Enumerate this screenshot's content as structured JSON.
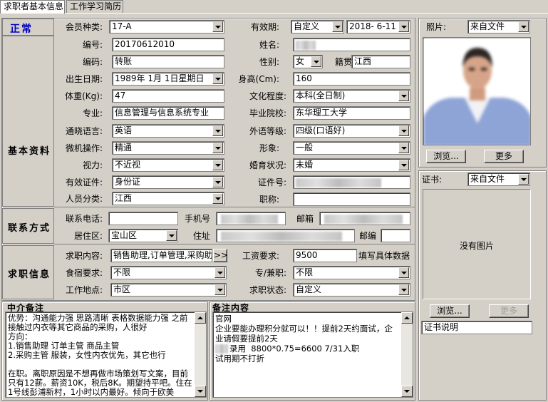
{
  "tabs": [
    {
      "label": "求职者基本信息"
    },
    {
      "label": "工作学习简历"
    }
  ],
  "status": {
    "text": "正常",
    "color": "#0000c0"
  },
  "sections": {
    "basic": "基本资料",
    "contact": "联系方式",
    "job": "求职信息",
    "agent_note": "中介备注",
    "remark": "备注内容"
  },
  "labels": {
    "member_type": "会员种类:",
    "validity": "有效期:",
    "number": "编号:",
    "name": "姓名:",
    "code": "编码:",
    "gender": "性别:",
    "native": "籍贯",
    "birth": "出生日期:",
    "height": "身高(Cm):",
    "weight": "体重(Kg):",
    "education": "文化程度:",
    "major": "专业:",
    "school": "毕业院校:",
    "dialect": "通晓语言:",
    "foreign": "外语等级:",
    "computer": "微机操作:",
    "appearance": "形象:",
    "vision": "视力:",
    "marital": "婚育状况:",
    "id_type": "有效证件:",
    "id_no": "证件号:",
    "category": "人员分类:",
    "title": "职称:",
    "phone": "联系电话:",
    "mobile": "手机号",
    "email": "邮箱",
    "area": "居住区:",
    "address": "住址",
    "zip": "邮编",
    "job_content": "求职内容:",
    "salary": "工资要求:",
    "salary_hint": "填写具体数据",
    "meal": "食宿要求:",
    "fulltime": "专/兼职:",
    "location": "工作地点:",
    "job_status": "求职状态:",
    "photo": "照片:",
    "cert": "证书:"
  },
  "values": {
    "member_type": "17-A",
    "validity_type": "自定义",
    "validity_date": "2018- 6-11",
    "number": "20170612010",
    "code": "转账",
    "gender": "女",
    "native": "江西",
    "birth": "1989年 1月 1日星期日",
    "height": "160",
    "weight": "47",
    "education": "本科(全日制)",
    "major": "信息管理与信息系统专业",
    "school": "东华理工大学",
    "dialect": "英语",
    "foreign": "四级(口语好)",
    "computer": "精通",
    "appearance": "一般",
    "vision": "不近视",
    "marital": "未婚",
    "id_type": "身份证",
    "category": "江西",
    "phone": "",
    "area": "宝山区",
    "zip": "",
    "job_content": "销售助理,订单管理,采购助",
    "salary": "9500",
    "meal": "不限",
    "fulltime": "不限",
    "location": "市区",
    "job_status": "自定义"
  },
  "photo": {
    "source": "来自文件",
    "browse": "浏览...",
    "more": "更多"
  },
  "cert": {
    "source": "来自文件",
    "empty": "没有图片",
    "browse": "浏览...",
    "more": "更多",
    "desc": "证书说明"
  },
  "more_btn": ">>",
  "agent_note_text": "优势：沟通能力强 思路清晰 表格数据能力强 之前接触过内衣等其它商品的采购，人很好\n方向：\n1.销售助理 订单主管 商品主管\n2.采购主管 服装，女性内衣优先，其它也行\n\n在职。离职原因是不想再做市场策划写文案，目前只有12薪。薪资10K，税后8K。期望持平吧。住在1号线彭浦新村，1小时以内最好。倾向于欧美",
  "remark_lines": [
    "官网",
    "",
    "企业要能办理积分就可以！！提前2天约面试，企业请假要提前2天",
    "",
    "录用  8800*0.75=6600 7/31入职",
    "",
    "试用期不打折"
  ]
}
